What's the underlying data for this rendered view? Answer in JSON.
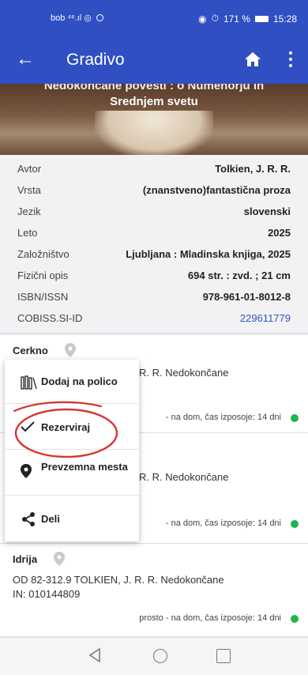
{
  "status_bar": {
    "left": "bob ⁴⁶.ıl ◎",
    "battery": "171 %",
    "time": "15:28"
  },
  "app_bar": {
    "title": "Gradivo"
  },
  "hero": {
    "title_partial": "Nedokončane povesti : o Númenorju in",
    "title_line2": "Srednjem svetu"
  },
  "details": [
    {
      "key": "Avtor",
      "value": "Tolkien, J. R. R."
    },
    {
      "key": "Vrsta",
      "value": "(znanstveno)fantastična proza"
    },
    {
      "key": "Jezik",
      "value": "slovenski"
    },
    {
      "key": "Leto",
      "value": "2025"
    },
    {
      "key": "Založništvo",
      "value": "Ljubljana : Mladinska knjiga, 2025"
    },
    {
      "key": "Fizični opis",
      "value": "694 str. : zvd. ; 21 cm"
    },
    {
      "key": "ISBN/ISSN",
      "value": "978-961-01-8012-8"
    },
    {
      "key": "COBISS.SI-ID",
      "value": "229611779"
    }
  ],
  "libraries": [
    {
      "name": "Cerkno",
      "call_partial": "R. R. Nedokončane",
      "status_partial": "- na dom, čas izposoje: 14 dni"
    },
    {
      "name": "",
      "call_partial": "R. R. Nedokončane",
      "status_partial": "- na dom, čas izposoje: 14 dni"
    },
    {
      "name": "Idrija",
      "call": "OD 82-312.9 TOLKIEN, J. R. R. Nedokončane",
      "inv": "IN: 010144809",
      "status": "prosto - na dom, čas izposoje: 14 dni"
    }
  ],
  "menu": {
    "items": [
      {
        "label": "Dodaj na polico",
        "icon": "bookshelf-icon"
      },
      {
        "label": "Rezerviraj",
        "icon": "checkmark-icon"
      },
      {
        "label": "Prevzemna mesta",
        "icon": "location-pin-icon"
      },
      {
        "label": "Deli",
        "icon": "share-icon"
      }
    ]
  },
  "colors": {
    "primary": "#2f4fc2",
    "available": "#1db64a",
    "link": "#2f56c8",
    "annotation": "#d9352f"
  }
}
